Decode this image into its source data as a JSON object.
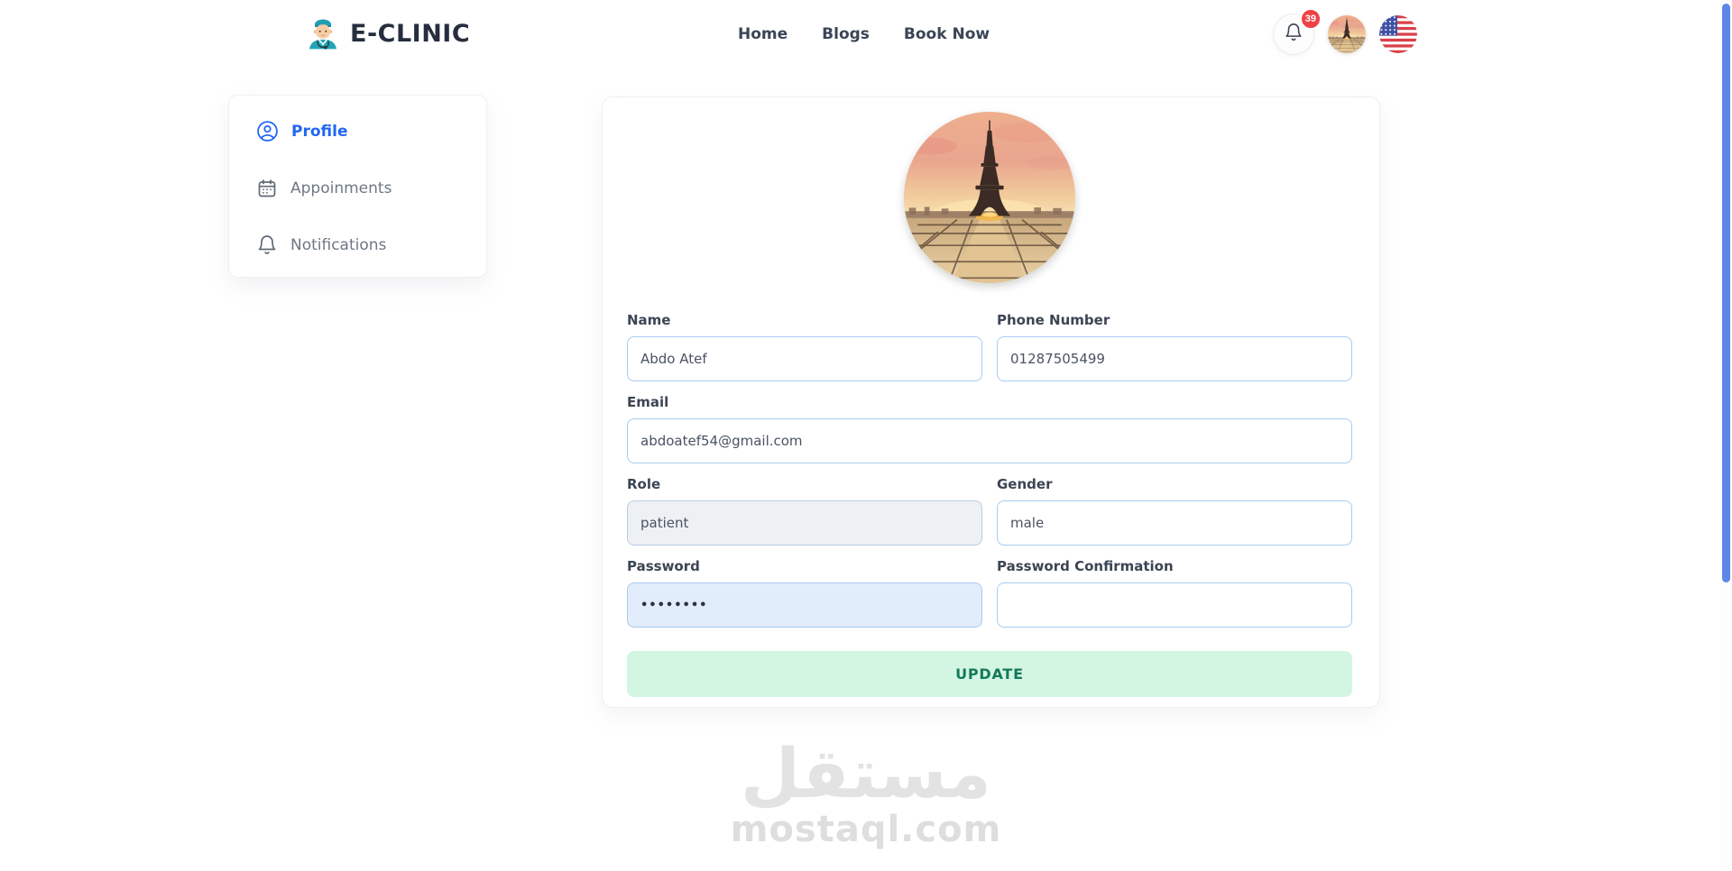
{
  "header": {
    "brand_name": "E-CLINIC",
    "nav": [
      {
        "label": "Home"
      },
      {
        "label": "Blogs"
      },
      {
        "label": "Book Now"
      }
    ],
    "notifications_count": "39",
    "icons": {
      "logo": "doctor-icon",
      "notifications": "bell-icon",
      "avatar": "eiffel-tower-photo",
      "language": "us-flag-icon"
    }
  },
  "sidebar": {
    "items": [
      {
        "label": "Profile",
        "icon": "person-circle-icon",
        "active": true
      },
      {
        "label": "Appoinments",
        "icon": "calendar-icon",
        "active": false
      },
      {
        "label": "Notifications",
        "icon": "bell-icon",
        "active": false
      }
    ]
  },
  "profile_form": {
    "avatar": "eiffel-tower-photo",
    "fields": {
      "name": {
        "label": "Name",
        "value": "Abdo Atef"
      },
      "phone": {
        "label": "Phone Number",
        "value": "01287505499"
      },
      "email": {
        "label": "Email",
        "value": "abdoatef54@gmail.com"
      },
      "role": {
        "label": "Role",
        "value": "patient"
      },
      "gender": {
        "label": "Gender",
        "value": "male"
      },
      "password": {
        "label": "Password",
        "value": "••••••••"
      },
      "password_confirmation": {
        "label": "Password Confirmation",
        "value": ""
      }
    },
    "submit_label": "UPDATE"
  },
  "watermark": {
    "arabic": "مستقل",
    "domain": "mostaql.com"
  },
  "colors": {
    "accent_blue": "#2166f3",
    "badge_red": "#ef4146",
    "button_bg": "#d2f6e2",
    "button_text": "#15795a",
    "input_border": "#a8cbf0",
    "password_bg": "#e2edfc",
    "role_bg": "#eef1f4",
    "scrollbar_thumb": "#5c87e8",
    "watermark_gray": "#e3e3e3"
  }
}
